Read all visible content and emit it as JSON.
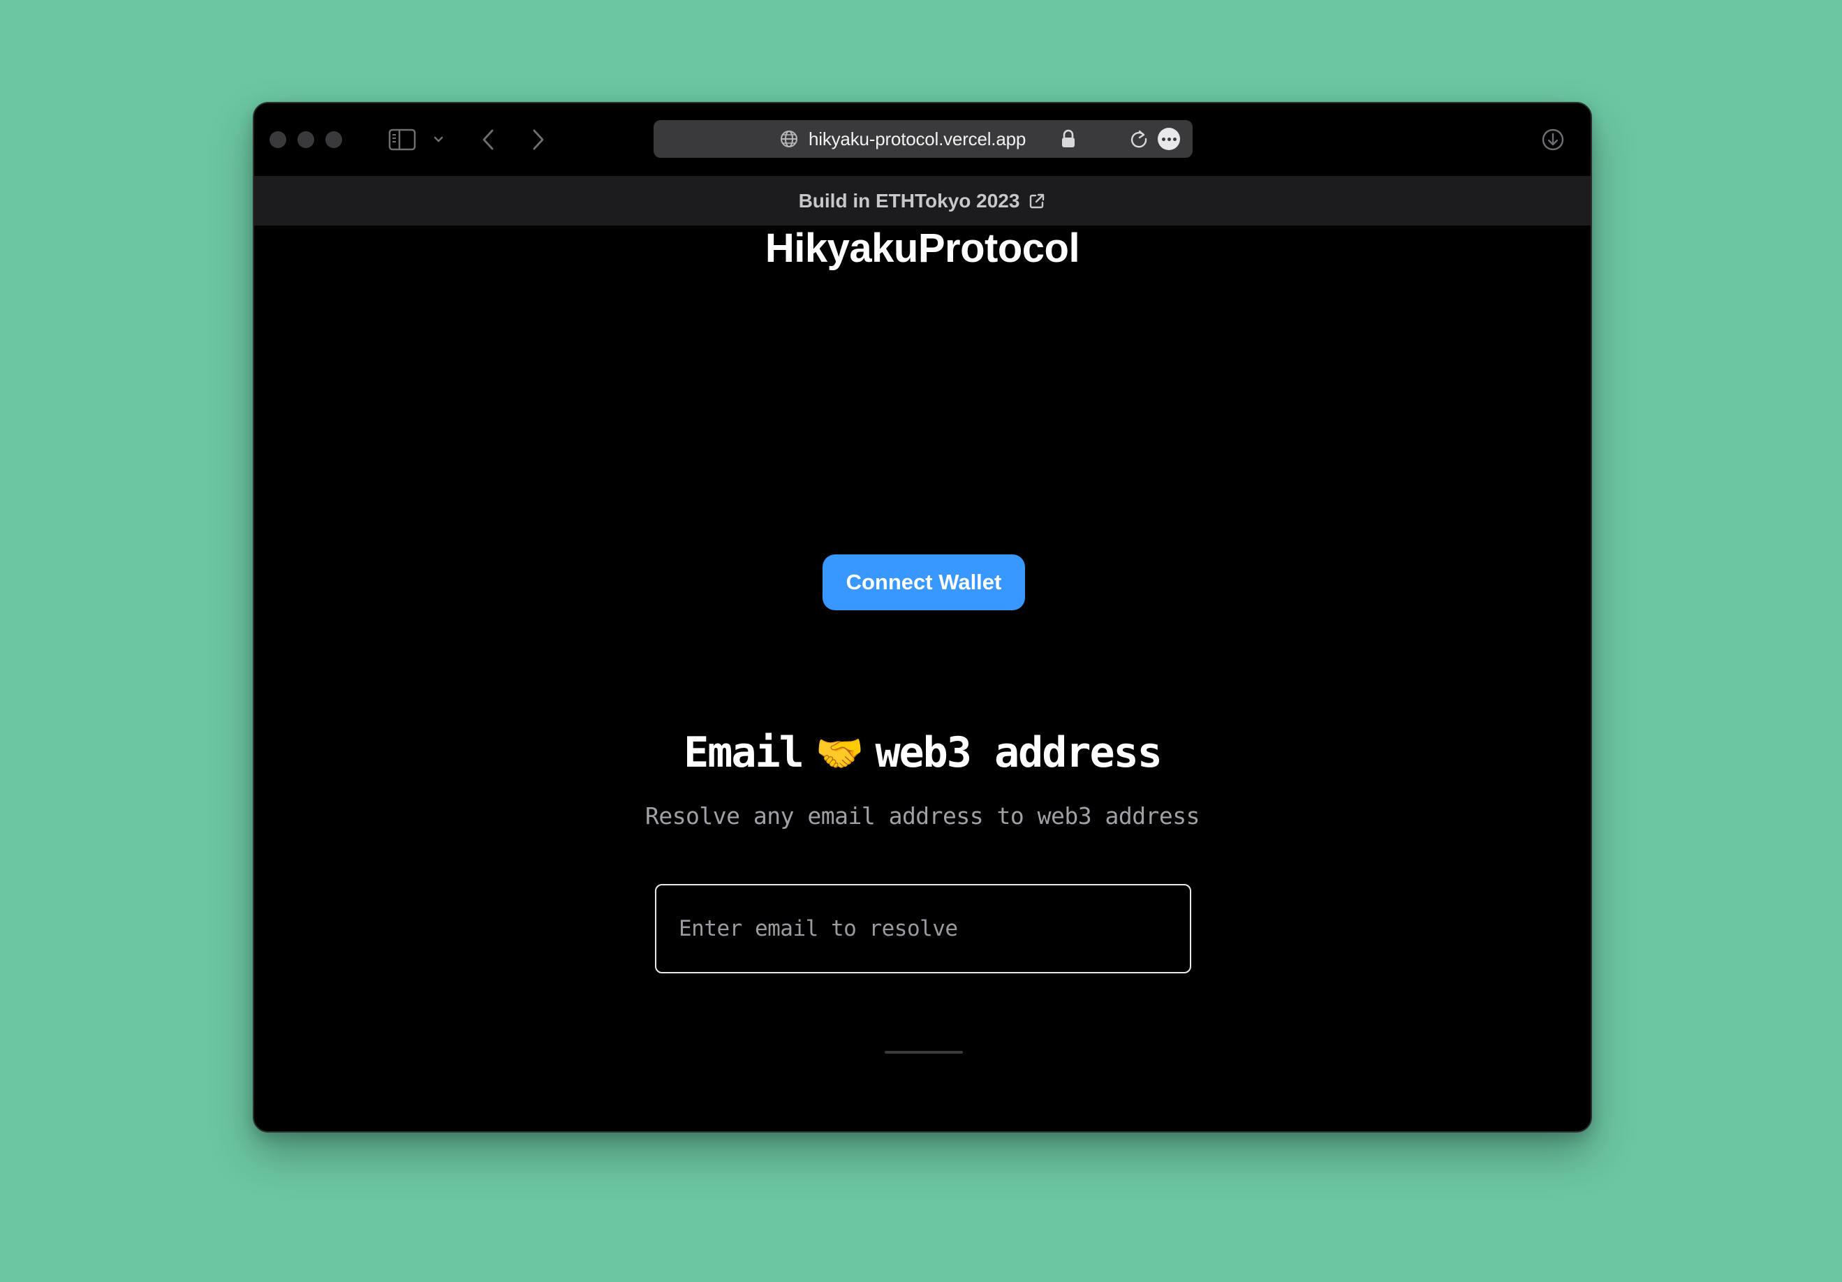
{
  "browser": {
    "url": "hikyaku-protocol.vercel.app",
    "icons": {
      "sidebar": "sidebar-icon",
      "chevron": "chevron-down-icon",
      "back": "back-arrow-icon",
      "forward": "forward-arrow-icon",
      "site": "globe-icon",
      "secure": "lock-icon",
      "reload": "reload-icon",
      "more": "more-ellipsis-icon",
      "downloads": "download-icon"
    }
  },
  "banner": {
    "text": "Build in ETHTokyo 2023",
    "icon": "external-link-icon"
  },
  "site": {
    "title": "HikyakuProtocol"
  },
  "wallet": {
    "connect_label": "Connect Wallet",
    "accent_color": "#3898ff"
  },
  "hero": {
    "title_left": "Email",
    "title_emoji": "🤝",
    "title_right": "web3 address",
    "subtitle": "Resolve any email address to web3 address"
  },
  "resolver": {
    "placeholder": "Enter email to resolve",
    "value": ""
  }
}
